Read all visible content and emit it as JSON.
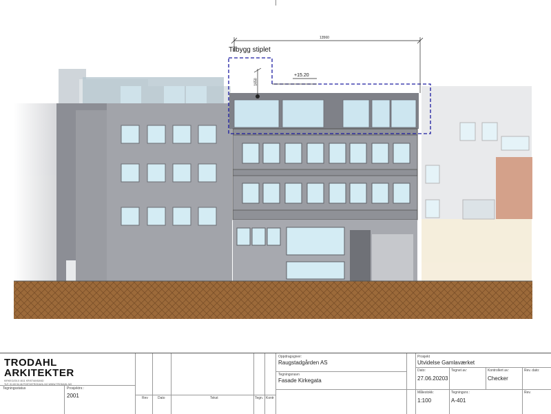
{
  "drawing": {
    "annotation": "Tilbygg stiplet",
    "dimension_width": "13560",
    "dimension_height": "1650",
    "level": "+15.20"
  },
  "title_block": {
    "firm_line1": "TRODAHL",
    "firm_line2": "ARKITEKTER",
    "firm_address": "KIRKEGATA 5    4611    KRISTIANSAND",
    "firm_contact": "TLF: 91 69 94 46    POST@TRODAHL.NO    WWW.TRODAHL.NO",
    "status_label": "Tegningsstatus",
    "project_no_label": "Prosjektnr.:",
    "project_no": "2001",
    "rev_col": "Rev",
    "date_col": "Dato",
    "text_col": "Tekst",
    "drawn_col": "Tegn.",
    "checked_col": "Kontr",
    "client_label": "Oppdragsgiver:",
    "client": "Raugstadgården AS",
    "drawing_name_label": "Tegningsnavn",
    "drawing_name": "Fasade Kirkegata",
    "project_label": "Prosjekt",
    "project": "Utvidelse Gamlaværket",
    "date_label": "Dato:",
    "date": "27.06.20203",
    "drawn_by_label": "Tegnet av:",
    "checked_by_label": "Kontrollert av:",
    "checked_by": "Checker",
    "rev_label": "Rev. dato:",
    "scale_label": "Målestokk:",
    "scale": "1:100",
    "drawing_no_label": "Tegningsnr.:",
    "drawing_no": "A-401",
    "rev2_label": "Rev."
  },
  "colors": {
    "ground": "#9c6a3a",
    "facade_dark": "#8a8c93",
    "facade_mid": "#a3a5ab",
    "glass": "#cde6f0",
    "dash": "#1a1aa0"
  }
}
